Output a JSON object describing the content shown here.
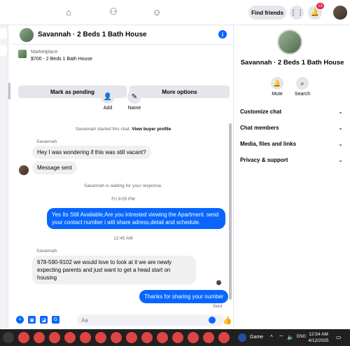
{
  "topnav": {
    "find_friends_label": "Find friends",
    "notification_count": "13",
    "icons": [
      "home-icon",
      "friends-icon",
      "groups-icon",
      "menu-grid-icon",
      "bell-icon",
      "account-avatar"
    ]
  },
  "chat": {
    "title": "Savannah · 2 Beds 1 Bath House",
    "marketplace_label": "Marketplace",
    "listing": "$700 - 2 Beds 1 Bath House",
    "mark_pending_label": "Mark as pending",
    "more_options_label": "More options",
    "add_label": "Add",
    "name_label": "Name",
    "started_text": "Savannah started this chat.",
    "view_buyer_profile": "View buyer profile",
    "sender_name_1": "Savannah",
    "msg_1": "Hey I was wondering if this was still vacant?",
    "msg_2": "Message sent",
    "waiting_text": "Savannah is waiting for your response.",
    "time_1": "Fri 9:05 PM",
    "msg_out_1": "Yes Its Still Available,Are you intrested viewing the Apartment. send your contact number i will share adress,detail and schedule.",
    "time_2": "12:45 AM",
    "sender_name_2": "Savannah",
    "msg_3": "678-590-9102 we would love to look at it we are newly expecting parents and just want to get a head start on housing",
    "msg_out_2": "Thanks for sharing your number",
    "sent_label": "Sent",
    "composer_placeholder": "Aa"
  },
  "right_panel": {
    "title": "Savannah · 2 Beds 1 Bath House",
    "mute_label": "Mute",
    "search_label": "Search",
    "items": [
      {
        "label": "Customize chat"
      },
      {
        "label": "Chat members"
      },
      {
        "label": "Media, files and links"
      },
      {
        "label": "Privacy & support"
      }
    ]
  },
  "taskbar": {
    "game_label": "Game",
    "lang": "ENG",
    "time": "12:54 AM",
    "date": "4/12/2025"
  },
  "colors": {
    "accent": "#0866ff",
    "bubble_in": "#f0f0f0",
    "taskbar": "#202020"
  }
}
